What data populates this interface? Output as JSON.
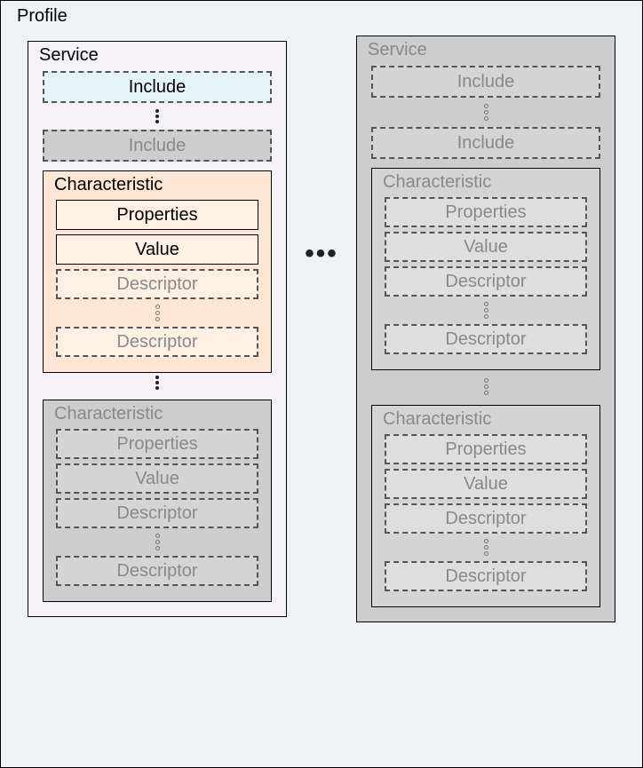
{
  "profile": {
    "title": "Profile"
  },
  "service": {
    "title": "Service"
  },
  "include": {
    "label": "Include"
  },
  "characteristic": {
    "title": "Characteristic"
  },
  "properties": {
    "label": "Properties"
  },
  "value": {
    "label": "Value"
  },
  "descriptor": {
    "label": "Descriptor"
  }
}
